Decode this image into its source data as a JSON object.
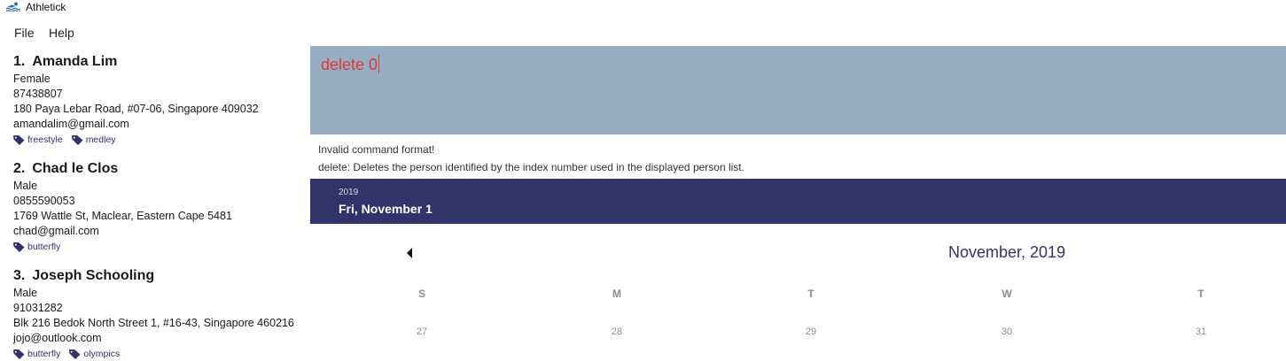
{
  "window": {
    "title": "Athletick",
    "icon": "swimmer-icon"
  },
  "menu": {
    "items": [
      "File",
      "Help"
    ]
  },
  "persons": [
    {
      "index": "1.",
      "name": "Amanda Lim",
      "gender": "Female",
      "phone": "87438807",
      "address": "180 Paya Lebar Road, #07-06, Singapore 409032",
      "email": "amandalim@gmail.com",
      "tags": [
        "freestyle",
        "medley"
      ]
    },
    {
      "index": "2.",
      "name": "Chad le Clos",
      "gender": "Male",
      "phone": "0855590053",
      "address": "1769 Wattle St, Maclear, Eastern Cape 5481",
      "email": "chad@gmail.com",
      "tags": [
        "butterfly"
      ]
    },
    {
      "index": "3.",
      "name": "Joseph Schooling",
      "gender": "Male",
      "phone": "91031282",
      "address": "Blk 216 Bedok North Street 1, #16-43, Singapore 460216",
      "email": "jojo@outlook.com",
      "tags": [
        "butterfly",
        "olympics"
      ]
    }
  ],
  "command": {
    "value": "delete 0",
    "text_color": "#e0383b",
    "box_color": "#97aec2"
  },
  "result": {
    "line1": "Invalid command format!",
    "line2": "delete: Deletes the person identified by the index number used in the displayed person list."
  },
  "calendar": {
    "header_color": "#32336b",
    "year": "2019",
    "selected_date": "Fri, November 1",
    "month_label": "November, 2019",
    "days_of_week": [
      "S",
      "M",
      "T",
      "W",
      "T"
    ],
    "visible_days": [
      "27",
      "28",
      "29",
      "30",
      "31"
    ]
  }
}
